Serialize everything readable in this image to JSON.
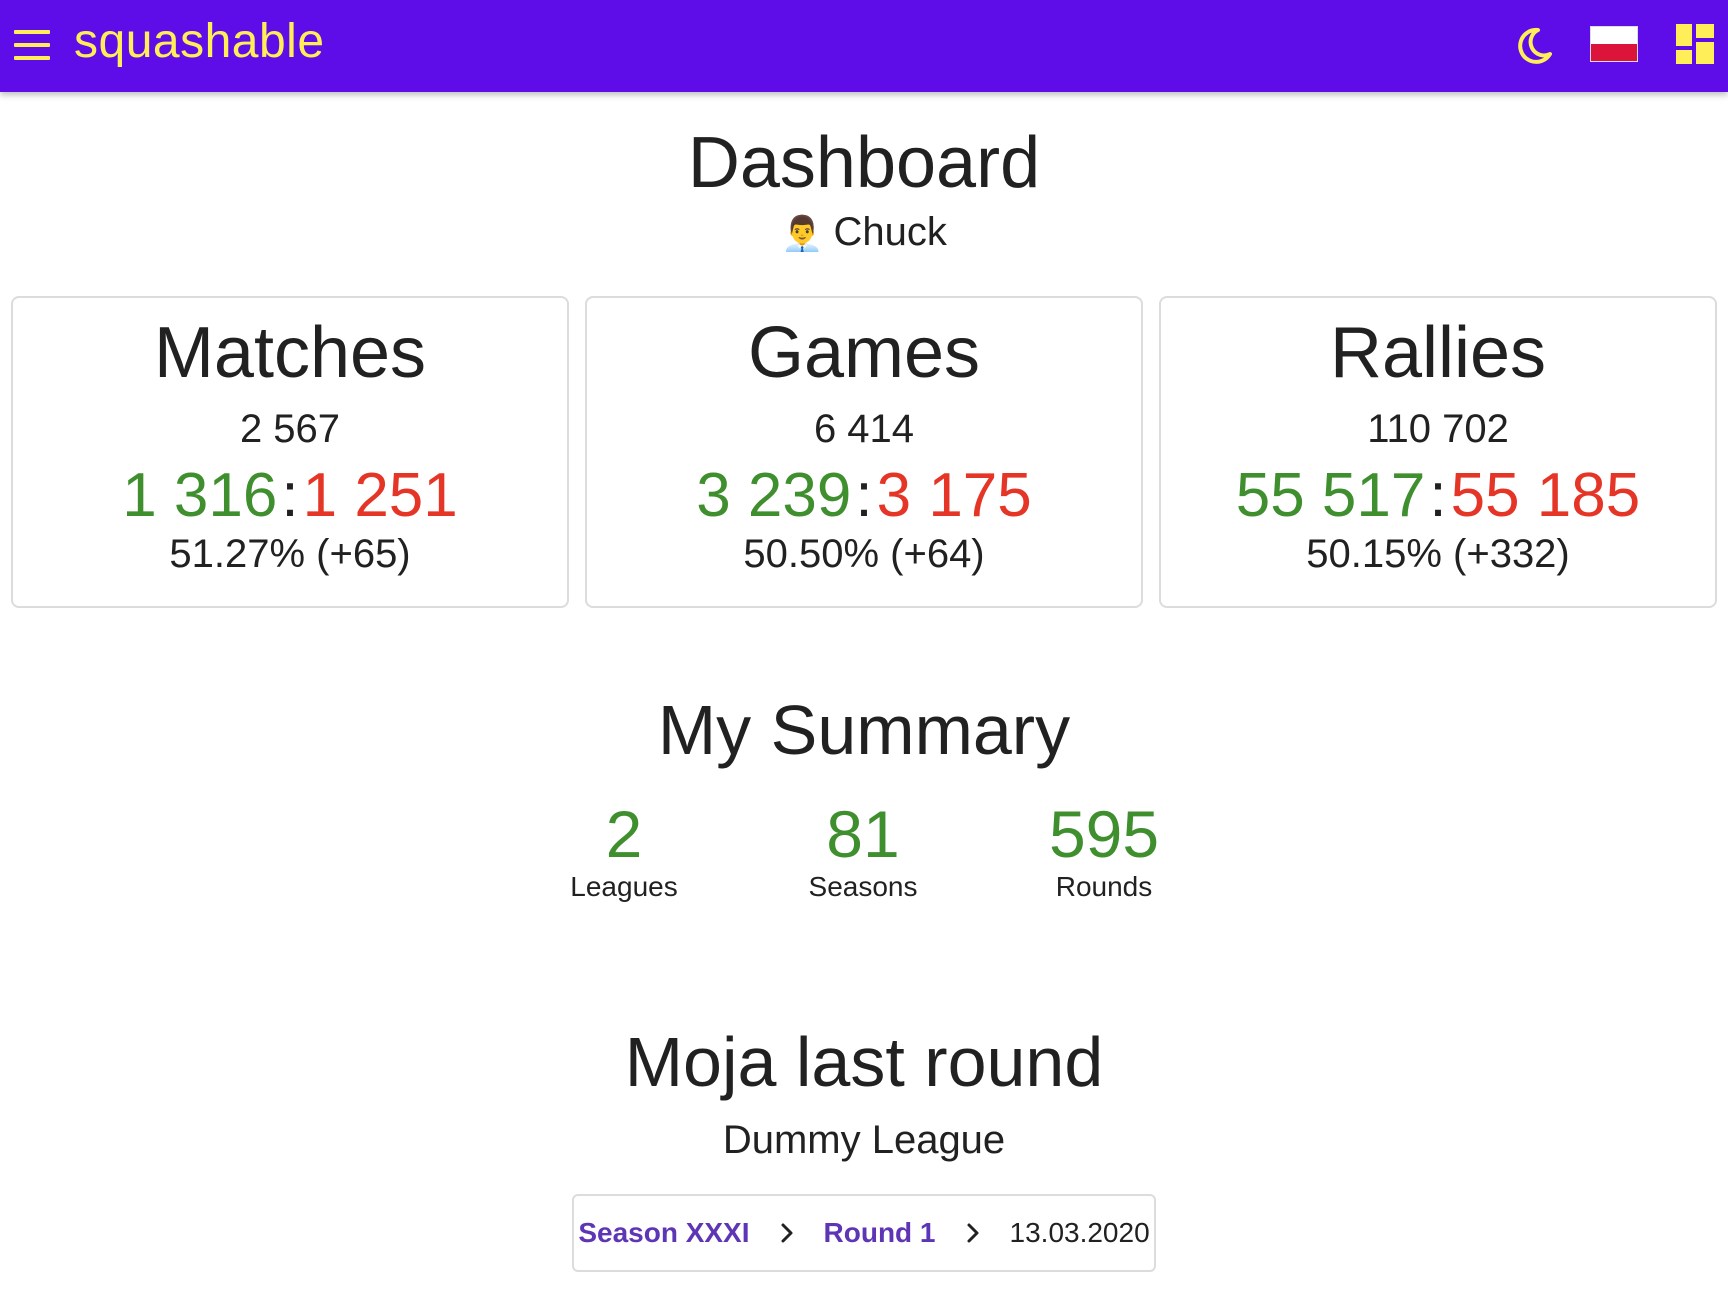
{
  "app": {
    "brand": "squashable",
    "icons": [
      "menu-icon",
      "moon-icon",
      "poland-flag-icon",
      "dashboard-icon"
    ],
    "colors": {
      "appbar": "#5e0de8",
      "accent": "#ffee58",
      "won": "#3f8f2f",
      "lost": "#e53527",
      "link": "#5d35b5"
    }
  },
  "page": {
    "title": "Dashboard",
    "user_emoji": "👨‍💼",
    "user_name": "Chuck"
  },
  "stats": [
    {
      "title": "Matches",
      "total": "2 567",
      "won": "1 316",
      "lost": "1 251",
      "ratio": "51.27% (+65)"
    },
    {
      "title": "Games",
      "total": "6 414",
      "won": "3 239",
      "lost": "3 175",
      "ratio": "50.50% (+64)"
    },
    {
      "title": "Rallies",
      "total": "110 702",
      "won": "55 517",
      "lost": "55 185",
      "ratio": "50.15% (+332)"
    }
  ],
  "stat_separator": ":",
  "summary": {
    "title": "My Summary",
    "items": [
      {
        "value": "2",
        "label": "Leagues"
      },
      {
        "value": "81",
        "label": "Seasons"
      },
      {
        "value": "595",
        "label": "Rounds"
      }
    ]
  },
  "last_round": {
    "title": "Moja last round",
    "league": "Dummy League",
    "breadcrumb": {
      "season": "Season XXXI",
      "round": "Round 1",
      "date": "13.03.2020"
    }
  }
}
